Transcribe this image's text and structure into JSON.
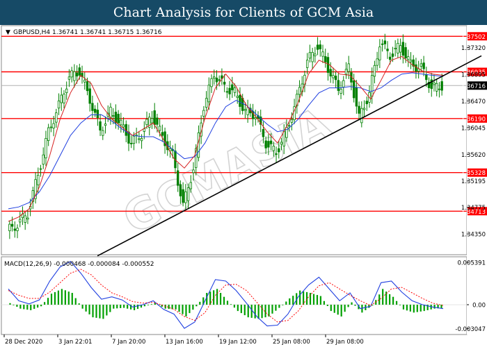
{
  "header": {
    "title": "Chart Analysis for Clients of GCM Asia"
  },
  "symbol_info": "GBPUSD,H4  1.36741 1.36741 1.36715 1.36716",
  "watermark": "GCMASIA",
  "colors": {
    "title_bar": "#164a66",
    "candle": "#008000",
    "ma_fast": "#d62020",
    "ma_slow": "#1f3fe0",
    "level_line": "#ff0000",
    "trendline": "#000000",
    "macd_line": "#1f3fe0",
    "signal_line": "#ff0000",
    "histogram": "#00a000",
    "current_price_tag": "#000000"
  },
  "chart_data": [
    {
      "type": "candlestick",
      "title": "",
      "x_tick_labels": [
        "28 Dec 2020",
        "3 Jan 22:01",
        "7 Jan 20:00",
        "13 Jan 16:00",
        "19 Jan 12:00",
        "25 Jan 08:00",
        "29 Jan 08:00"
      ],
      "y_tick_labels": [
        "1.37320",
        "1.36895",
        "1.36470",
        "1.36045",
        "1.35620",
        "1.35195",
        "1.34775",
        "1.34350"
      ],
      "ylim": [
        1.3403,
        1.3766
      ],
      "horizontal_levels": [
        1.37502,
        1.36935,
        1.3619,
        1.35328,
        1.34713
      ],
      "current_price": 1.36716,
      "trendline": {
        "from": {
          "x": "7 Jan 02:00",
          "y": 1.34
        },
        "to": {
          "x": "30 Jan 12:00",
          "y": 1.3719
        }
      },
      "series": [
        {
          "name": "",
          "type": "moving-average-fast",
          "values": [
            1.3455,
            1.3462,
            1.3475,
            1.351,
            1.356,
            1.3618,
            1.366,
            1.3688,
            1.3675,
            1.364,
            1.3618,
            1.3605,
            1.3592,
            1.3602,
            1.3612,
            1.3585,
            1.3555,
            1.354,
            1.356,
            1.362,
            1.3668,
            1.369,
            1.367,
            1.364,
            1.362,
            1.3598,
            1.358,
            1.361,
            1.3645,
            1.369,
            1.3712,
            1.3705,
            1.369,
            1.3688,
            1.367,
            1.365,
            1.368,
            1.3712,
            1.3718,
            1.3705,
            1.3695,
            1.369,
            1.3688
          ]
        },
        {
          "name": "",
          "type": "moving-average-slow",
          "values": [
            1.3475,
            1.3478,
            1.3485,
            1.3502,
            1.3528,
            1.356,
            1.3592,
            1.3612,
            1.3625,
            1.3625,
            1.3615,
            1.3602,
            1.3592,
            1.359,
            1.359,
            1.3582,
            1.3568,
            1.3555,
            1.3558,
            1.358,
            1.3612,
            1.3638,
            1.3648,
            1.364,
            1.3625,
            1.361,
            1.3598,
            1.3602,
            1.3618,
            1.364,
            1.366,
            1.3668,
            1.3668,
            1.367,
            1.3668,
            1.3662,
            1.3668,
            1.368,
            1.369,
            1.3692,
            1.369,
            1.3688,
            1.3686
          ]
        }
      ],
      "candles_close": [
        1.344,
        1.345,
        1.3468,
        1.353,
        1.3598,
        1.364,
        1.3685,
        1.3695,
        1.365,
        1.36,
        1.363,
        1.361,
        1.358,
        1.3595,
        1.3625,
        1.359,
        1.356,
        1.348,
        1.354,
        1.364,
        1.369,
        1.367,
        1.366,
        1.363,
        1.3625,
        1.358,
        1.3565,
        1.36,
        1.365,
        1.371,
        1.3735,
        1.37,
        1.3665,
        1.37,
        1.362,
        1.366,
        1.374,
        1.372,
        1.3735,
        1.3705,
        1.37,
        1.3668,
        1.36716
      ]
    },
    {
      "type": "line",
      "title": "MACD(12,26,9) -0.000468 -0.000084 -0.000552",
      "y_tick_labels": [
        "0.005391",
        "0.00",
        "-0.003047"
      ],
      "ylim": [
        -0.0037,
        0.006
      ],
      "series": [
        {
          "name": "MACD",
          "values": [
            0.002,
            0.0005,
            0.0001,
            0.0006,
            0.003,
            0.0048,
            0.0055,
            0.004,
            0.0022,
            0.0007,
            0.001,
            0.0006,
            -0.0003,
            0.0,
            0.0005,
            -0.0006,
            -0.0012,
            -0.003,
            -0.0022,
            0.0005,
            0.0032,
            0.003,
            0.0018,
            0.0002,
            -0.0015,
            -0.0027,
            -0.0026,
            -0.0012,
            0.001,
            0.0025,
            0.0035,
            0.002,
            0.0005,
            0.0015,
            -0.0005,
            -0.0002,
            0.0028,
            0.003,
            0.0016,
            0.0005,
            0.0,
            -0.0003,
            -0.0005
          ]
        },
        {
          "name": "Signal",
          "values": [
            0.0018,
            0.0012,
            0.0008,
            0.0008,
            0.0016,
            0.0028,
            0.004,
            0.0045,
            0.0038,
            0.0025,
            0.0015,
            0.001,
            0.0004,
            0.0002,
            0.0003,
            -0.0001,
            -0.0006,
            -0.0015,
            -0.002,
            -0.001,
            0.0012,
            0.0025,
            0.0026,
            0.0018,
            0.0003,
            -0.0012,
            -0.0022,
            -0.002,
            -0.0008,
            0.001,
            0.0024,
            0.0028,
            0.002,
            0.0012,
            0.0005,
            -0.0001,
            0.0008,
            0.002,
            0.0022,
            0.0015,
            0.0008,
            0.0002,
            -0.0001
          ]
        },
        {
          "name": "Histogram",
          "values": [
            0.0002,
            -0.0005,
            -0.0007,
            -0.0002,
            0.0014,
            0.002,
            0.0015,
            -0.0005,
            -0.0016,
            -0.0018,
            -0.0005,
            -0.0004,
            -0.0007,
            -0.0002,
            0.0002,
            -0.0005,
            -0.0006,
            -0.0015,
            -0.0002,
            0.0015,
            0.002,
            0.0005,
            -0.0008,
            -0.0016,
            -0.0018,
            -0.0015,
            -0.0004,
            0.0008,
            0.0018,
            0.0015,
            0.0011,
            -0.0008,
            -0.0015,
            0.0003,
            -0.001,
            -0.0001,
            0.002,
            0.001,
            -0.0006,
            -0.001,
            -0.0008,
            -0.0005,
            -0.0004
          ]
        }
      ]
    }
  ]
}
